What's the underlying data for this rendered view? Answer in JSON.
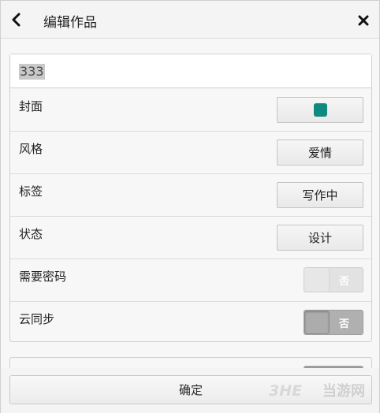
{
  "header": {
    "title": "编辑作品",
    "back_icon": "chevron-left-icon",
    "close_icon": "close-icon"
  },
  "work_name": {
    "value": "333"
  },
  "rows": {
    "cover": {
      "label": "封面",
      "swatch_color": "#0e8a80"
    },
    "style": {
      "label": "风格",
      "value": "爱情"
    },
    "tag": {
      "label": "标签",
      "value": "写作中"
    },
    "status": {
      "label": "状态",
      "value": "设计"
    },
    "password": {
      "label": "需要密码",
      "toggle_text": "否"
    },
    "cloud_sync": {
      "label": "云同步",
      "toggle_text": "否"
    }
  },
  "footer": {
    "confirm_label": "确定"
  },
  "watermark": {
    "text": "当游网"
  }
}
